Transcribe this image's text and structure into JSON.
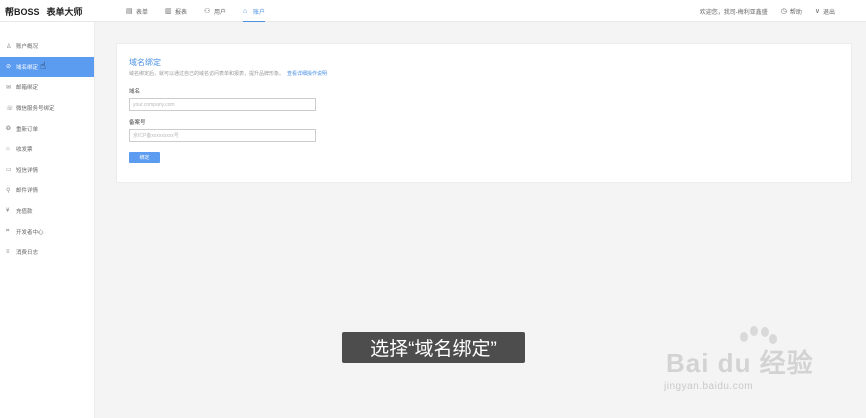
{
  "header": {
    "brand": "帮BOSS",
    "app_name": "表单大师",
    "nav": [
      {
        "label": "表单",
        "icon": "form-icon"
      },
      {
        "label": "报表",
        "icon": "chart-icon"
      },
      {
        "label": "用户",
        "icon": "user-icon"
      },
      {
        "label": "账户",
        "icon": "account-icon",
        "active": true
      }
    ],
    "welcome": "欢迎您，我司-梅利亚鑫盛",
    "help": "帮助",
    "logout": "退出"
  },
  "sidebar": {
    "items": [
      {
        "label": "账户概况",
        "icon": "account-overview-icon"
      },
      {
        "label": "域名绑定",
        "icon": "domain-bind-icon",
        "active": true
      },
      {
        "label": "邮箱绑定",
        "icon": "email-bind-icon"
      },
      {
        "label": "微信服务号绑定",
        "icon": "wechat-bind-icon"
      },
      {
        "label": "重新订单",
        "icon": "order-icon"
      },
      {
        "label": "收发票",
        "icon": "invoice-icon"
      },
      {
        "label": "短信详情",
        "icon": "sms-icon"
      },
      {
        "label": "邮件详情",
        "icon": "mail-detail-icon"
      },
      {
        "label": "充值款",
        "icon": "recharge-icon"
      },
      {
        "label": "开发者中心",
        "icon": "developer-icon"
      },
      {
        "label": "消费日志",
        "icon": "log-icon"
      }
    ]
  },
  "main": {
    "title": "域名绑定",
    "description": "域名绑定后，就可以通过自己的域名访问表单和报表，提升品牌形象。",
    "description_link": "查看详细操作说明",
    "fields": [
      {
        "label": "域名",
        "placeholder": "your.company.com"
      },
      {
        "label": "备案号",
        "placeholder": "京ICP备xxxxxxxxx号"
      }
    ],
    "bind_button": "绑定"
  },
  "caption": "选择“域名绑定”",
  "watermark": {
    "logo": "Bai du 经验",
    "url": "jingyan.baidu.com"
  },
  "colors": {
    "accent": "#4a90e2",
    "active_sidebar": "#5b9bf0",
    "background": "#f4f4f5"
  }
}
